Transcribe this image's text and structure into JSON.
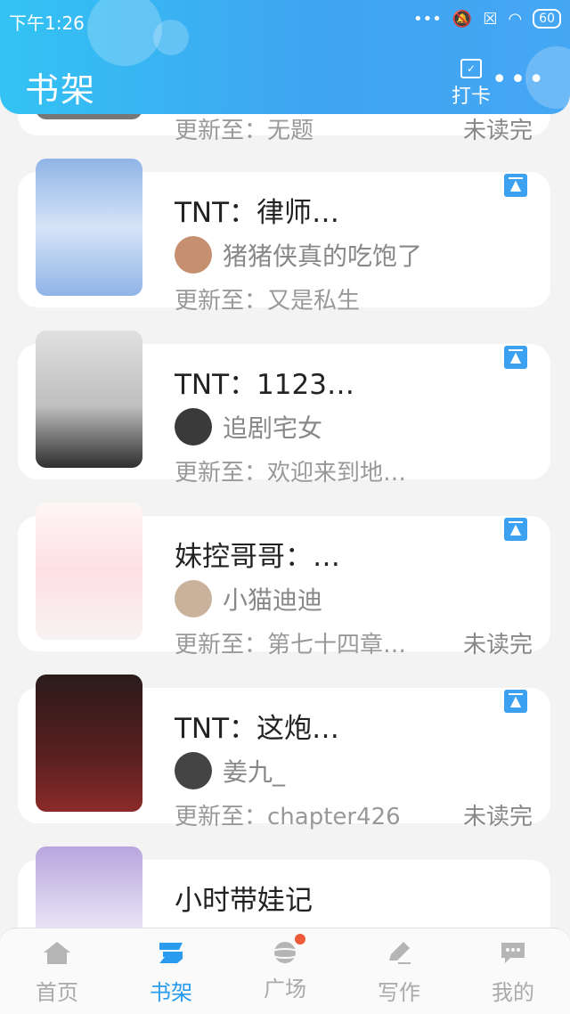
{
  "status_bar": {
    "time": "下午1:26",
    "battery": "60"
  },
  "header": {
    "title": "书架",
    "checkin_label": "打卡"
  },
  "top_card": {
    "update": "更新至：无题",
    "status": "未读完"
  },
  "books": [
    {
      "title": "TNT：律师…",
      "author": "猪猪侠真的吃饱了",
      "update": "更新至：又是私生",
      "status": "",
      "cover_colors": [
        "#8fb4e6",
        "#d6e4f7"
      ],
      "avatar_color": "#c58f70"
    },
    {
      "title": "TNT：1123…",
      "author": "追剧宅女",
      "update": "更新至：欢迎来到地…",
      "status": "",
      "cover_colors": [
        "#bfbfbf",
        "#3b3b3b"
      ],
      "avatar_color": "#3a3a3a"
    },
    {
      "title": "妹控哥哥：…",
      "author": "小猫迪迪",
      "update": "更新至：第七十四章…",
      "status": "未读完",
      "cover_colors": [
        "#fff6f6",
        "#f3b3bd"
      ],
      "avatar_color": "#c9b19c"
    },
    {
      "title": "TNT：这炮…",
      "author": "姜九_",
      "update": "更新至：chapter426",
      "status": "未读完",
      "cover_colors": [
        "#2b1b1b",
        "#8c2a2a"
      ],
      "avatar_color": "#444444"
    },
    {
      "title": "小时带娃记",
      "author": "",
      "update": "",
      "status": "",
      "cover_colors": [
        "#b7a6de",
        "#e9e4f5"
      ],
      "avatar_color": "#a098d0"
    }
  ],
  "nav": [
    {
      "label": "首页",
      "icon": "home-icon",
      "active": false
    },
    {
      "label": "书架",
      "icon": "bookshelf-icon",
      "active": true
    },
    {
      "label": "广场",
      "icon": "planet-icon",
      "active": false,
      "badge": true
    },
    {
      "label": "写作",
      "icon": "pen-icon",
      "active": false
    },
    {
      "label": "我的",
      "icon": "chat-icon",
      "active": false
    }
  ],
  "colors": {
    "accent": "#2a9cf0",
    "header_start": "#33c3f3",
    "header_end": "#45a7f4"
  }
}
